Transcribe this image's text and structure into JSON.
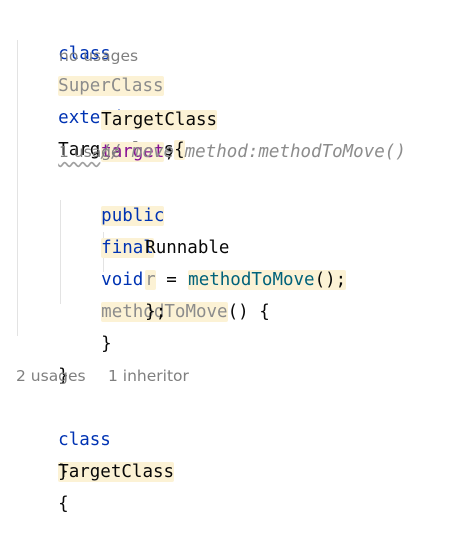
{
  "code": {
    "l1": {
      "kw_class": "class",
      "name": "SuperClass",
      "kw_extends": "extends",
      "parent": "TargetClass",
      "brace": "{"
    },
    "hint_no_usages": "no usages",
    "l2": {
      "type": "TargetClass",
      "field": "target",
      "semi": ";"
    },
    "l3": {
      "comment": "// move method:methodToMove()"
    },
    "hint_one_usage": "1 usage",
    "l4": {
      "kw_public": "public",
      "kw_final": "final",
      "kw_void": "void",
      "method": "methodToMove",
      "rest": "() {"
    },
    "l5": {
      "type": "Runnable",
      "var": "r",
      "rest": " = () -> ",
      "brace": "{"
    },
    "l6": {
      "call": "methodToMove",
      "rest": "();"
    },
    "l7": {
      "text": "};"
    },
    "l8": {
      "text": "}"
    },
    "l9": {
      "text": "}"
    },
    "hint_usages": "2 usages",
    "hint_inheritor": "1 inheritor",
    "l10": {
      "kw_class": "class",
      "name": "TargetClass",
      "brace": "{"
    },
    "l11": {
      "text": "}"
    }
  }
}
